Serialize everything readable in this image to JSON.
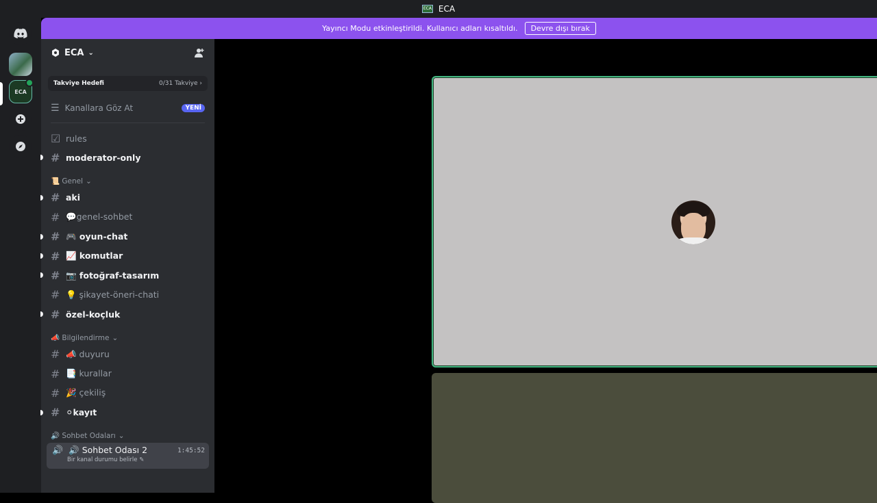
{
  "titlebar": {
    "server_icon_text": "ECA",
    "title": "ECA"
  },
  "banner": {
    "message": "Yayıncı Modu etkinleştirildi. Kullanıcı adları kısaltıldı.",
    "disable_label": "Devre dışı bırak",
    "color": "#8c52ee"
  },
  "guilds": {
    "server2_icon_text": "ECA"
  },
  "server": {
    "name": "ECA",
    "boost_label": "Takviye Hedefi",
    "boost_progress": "0/31 Takviye",
    "browse_label": "Kanallara Göz At",
    "new_badge": "YENİ"
  },
  "channels_top": [
    {
      "icon": "rules-icon",
      "name": "rules",
      "unread": false
    },
    {
      "icon": "hash",
      "name": "moderator-only",
      "unread": true
    }
  ],
  "categories": [
    {
      "name": "📜 Genel",
      "channels": [
        {
          "name": "aki",
          "unread": true
        },
        {
          "name": "💬genel-sohbet",
          "unread": false
        },
        {
          "name": "🎮 oyun-chat",
          "unread": true
        },
        {
          "name": "📈 komutlar",
          "unread": true
        },
        {
          "name": "📷 fotoğraf-tasarım",
          "unread": true
        },
        {
          "name": "💡 şikayet-öneri-chati",
          "unread": false
        },
        {
          "name": "özel-koçluk",
          "unread": true
        }
      ]
    },
    {
      "name": "📣 Bilgilendirme",
      "channels": [
        {
          "name": "📣 duyuru",
          "unread": false
        },
        {
          "name": "📑 kurallar",
          "unread": false
        },
        {
          "name": "🎉 çekiliş",
          "unread": false
        },
        {
          "name": "⚪kayıt",
          "unread": true
        }
      ]
    }
  ],
  "voice_category": "🔊 Sohbet Odaları",
  "voice_channel": {
    "name": "🔊 Sohbet Odası 2",
    "time": "1:45:52",
    "status": "Bir kanal durumu belirle ✎"
  },
  "stage": {
    "active_border_color": "#43b581",
    "top_tile_bg": "#c4c2c2",
    "bottom_tile_bg": "#4b4d3c"
  }
}
